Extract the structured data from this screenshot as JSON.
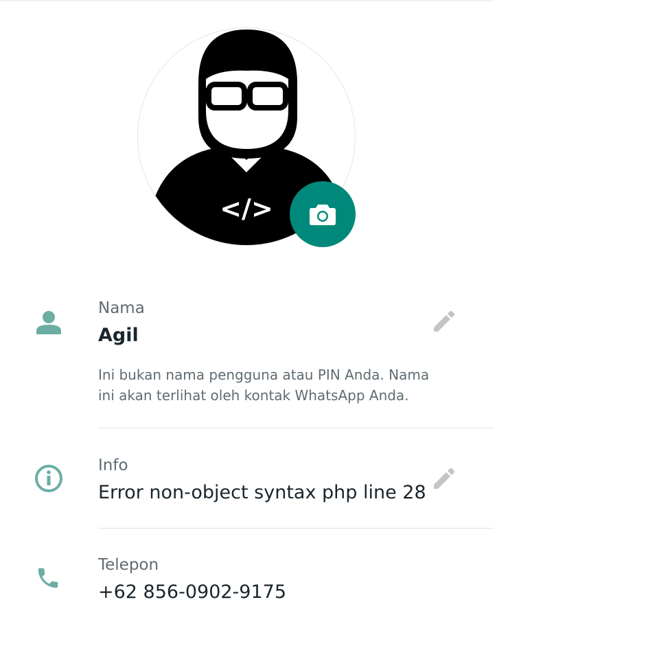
{
  "profile": {
    "photo_icon": "developer-avatar-icon",
    "camera_icon": "camera-icon",
    "accent_color": "#00897b",
    "icon_color": "#6aaea4"
  },
  "name_row": {
    "icon": "person-icon",
    "label": "Nama",
    "value": "Agil",
    "hint": "Ini bukan nama pengguna atau PIN Anda. Nama ini akan terlihat oleh kontak WhatsApp Anda.",
    "edit_icon": "pencil-icon"
  },
  "info_row": {
    "icon": "info-icon",
    "label": "Info",
    "value": "Error non-object syntax php line 28",
    "edit_icon": "pencil-icon"
  },
  "phone_row": {
    "icon": "phone-icon",
    "label": "Telepon",
    "value": "+62 856-0902-9175"
  },
  "avatar_text": "</>"
}
